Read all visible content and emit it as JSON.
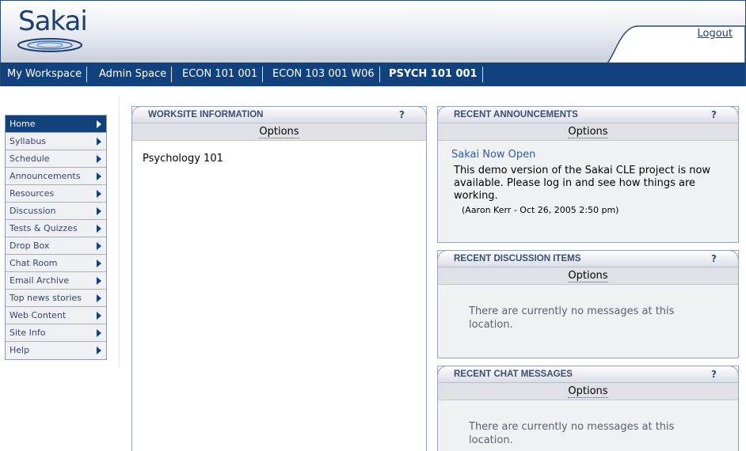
{
  "header": {
    "logo_text": "Sakai",
    "logout_label": "Logout"
  },
  "nav": {
    "tabs": [
      {
        "label": "My Workspace"
      },
      {
        "label": "Admin Space"
      },
      {
        "label": "ECON 101 001"
      },
      {
        "label": "ECON 103 001 W06"
      },
      {
        "label": "PSYCH 101 001",
        "active": true
      }
    ]
  },
  "sidebar": {
    "items": [
      {
        "label": "Home",
        "active": true
      },
      {
        "label": "Syllabus"
      },
      {
        "label": "Schedule"
      },
      {
        "label": "Announcements"
      },
      {
        "label": "Resources"
      },
      {
        "label": "Discussion"
      },
      {
        "label": "Tests & Quizzes"
      },
      {
        "label": "Drop Box"
      },
      {
        "label": "Chat Room"
      },
      {
        "label": "Email Archive"
      },
      {
        "label": "Top news stories"
      },
      {
        "label": "Web Content"
      },
      {
        "label": "Site Info"
      },
      {
        "label": "Help"
      }
    ]
  },
  "worksite": {
    "title": "WORKSITE INFORMATION",
    "help": "?",
    "options_label": "Options",
    "text": "Psychology 101"
  },
  "announcements": {
    "title": "RECENT ANNOUNCEMENTS",
    "help": "?",
    "options_label": "Options",
    "item_title": "Sakai Now Open",
    "item_body": "This demo version of the Sakai CLE project is now available.  Please log in and see how things are working.",
    "item_meta": "(Aaron Kerr - Oct 26, 2005 2:50 pm)"
  },
  "discussion": {
    "title": "RECENT DISCUSSION ITEMS",
    "help": "?",
    "options_label": "Options",
    "empty": "There are currently no messages at this location."
  },
  "chat": {
    "title": "RECENT CHAT MESSAGES",
    "help": "?",
    "options_label": "Options",
    "empty": "There are currently no messages at this location."
  },
  "colors": {
    "nav_bg": "#11427d",
    "link": "#2e5e9e",
    "title_text": "#3a4d72"
  }
}
